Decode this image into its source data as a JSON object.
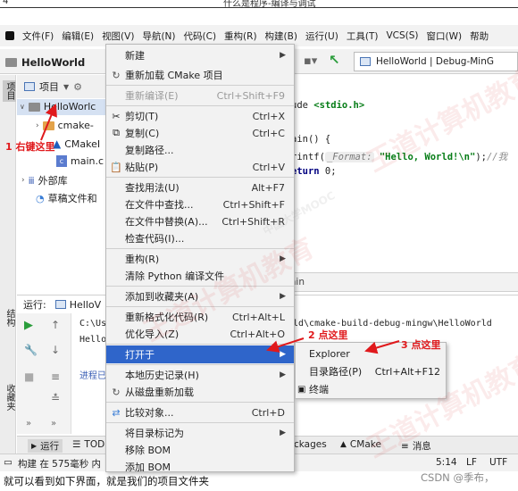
{
  "doc": {
    "page_number": "4",
    "header_title": "什么是程序-编译与调试",
    "caption": "就可以看到如下界面，就是我们的项目文件夹",
    "csdn_mark": "CSDN @季布，"
  },
  "menubar": {
    "items": [
      "文件(F)",
      "编辑(E)",
      "视图(V)",
      "导航(N)",
      "代码(C)",
      "重构(R)",
      "构建(B)",
      "运行(U)",
      "工具(T)",
      "VCS(S)",
      "窗口(W)",
      "帮助"
    ]
  },
  "toolbar": {
    "project_name": "HelloWorld",
    "run_config": "HelloWorld | Debug-MinG"
  },
  "left_strip": {
    "project_tab": "项目",
    "structure_tab": "结构",
    "favorites_tab": "收藏夹"
  },
  "project_panel": {
    "header_label": "项目",
    "tree": [
      {
        "label": "HelloWorlc",
        "indent": 0
      },
      {
        "label": "cmake-",
        "indent": 1
      },
      {
        "label": "CMakeI",
        "indent": 1
      },
      {
        "label": "main.c",
        "indent": 1
      },
      {
        "label": "外部库",
        "indent": 0
      },
      {
        "label": "草稿文件和",
        "indent": 0
      }
    ]
  },
  "editor": {
    "lines": [
      {
        "pre": "ude ",
        "kw": "",
        "str": "<stdio.h>",
        "hint": "",
        "post": "",
        "cmt": ""
      },
      {
        "pre": "ain() {",
        "kw": "",
        "str": "",
        "hint": "",
        "post": "",
        "cmt": ""
      },
      {
        "pre": "rintf(",
        "kw": "",
        "str": "\"Hello, World!\\n\"",
        "hint": "_Format:",
        "post": ");",
        "cmt": "//我"
      },
      {
        "pre": "",
        "kw": "eturn",
        "str": "",
        "hint": "",
        "post": " 0;",
        "cmt": ""
      }
    ],
    "tab_fragment": "ain"
  },
  "run_panel": {
    "label": "运行:",
    "tab": "HelloV",
    "console": [
      {
        "text": "C:\\Us",
        "tail": "ld\\cmake-build-debug-mingw\\HelloWorld"
      },
      {
        "text": "Hello",
        "tail": ""
      },
      {
        "text": "",
        "tail": ""
      },
      {
        "text": "进程已",
        "tail": ""
      }
    ]
  },
  "bottom_tabs": {
    "run": "运行",
    "todo": "TOD",
    "packages": "ckages",
    "cmake": "CMake",
    "messages": "消息"
  },
  "status_bar": {
    "build_msg": "构建 在 575毫秒 内",
    "position": "5:14",
    "line_sep": "LF",
    "encoding": "UTF"
  },
  "context_menu": {
    "items": [
      {
        "label": "新建",
        "shortcut": "",
        "submenu": true,
        "icon": "",
        "disabled": false
      },
      {
        "label": "重新加载 CMake 项目",
        "shortcut": "",
        "submenu": false,
        "icon": "cmake",
        "disabled": false
      },
      {
        "label": "重新编译(E)",
        "shortcut": "Ctrl+Shift+F9",
        "submenu": false,
        "icon": "",
        "disabled": true
      },
      {
        "label": "剪切(T)",
        "shortcut": "Ctrl+X",
        "submenu": false,
        "icon": "scissors",
        "disabled": false
      },
      {
        "label": "复制(C)",
        "shortcut": "Ctrl+C",
        "submenu": false,
        "icon": "copy",
        "disabled": false
      },
      {
        "label": "复制路径...",
        "shortcut": "",
        "submenu": false,
        "icon": "",
        "disabled": false
      },
      {
        "label": "粘贴(P)",
        "shortcut": "Ctrl+V",
        "submenu": false,
        "icon": "paste",
        "disabled": false
      },
      {
        "label": "查找用法(U)",
        "shortcut": "Alt+F7",
        "submenu": false,
        "icon": "",
        "disabled": false
      },
      {
        "label": "在文件中查找...",
        "shortcut": "Ctrl+Shift+F",
        "submenu": false,
        "icon": "",
        "disabled": false
      },
      {
        "label": "在文件中替换(A)...",
        "shortcut": "Ctrl+Shift+R",
        "submenu": false,
        "icon": "",
        "disabled": false
      },
      {
        "label": "检查代码(I)...",
        "shortcut": "",
        "submenu": false,
        "icon": "",
        "disabled": false
      },
      {
        "label": "重构(R)",
        "shortcut": "",
        "submenu": true,
        "icon": "",
        "disabled": false
      },
      {
        "label": "清除 Python 编译文件",
        "shortcut": "",
        "submenu": false,
        "icon": "",
        "disabled": false
      },
      {
        "label": "添加到收藏夹(A)",
        "shortcut": "",
        "submenu": true,
        "icon": "",
        "disabled": false
      },
      {
        "label": "重新格式化代码(R)",
        "shortcut": "Ctrl+Alt+L",
        "submenu": false,
        "icon": "",
        "disabled": false
      },
      {
        "label": "优化导入(Z)",
        "shortcut": "Ctrl+Alt+O",
        "submenu": false,
        "icon": "",
        "disabled": false
      },
      {
        "label": "打开于",
        "shortcut": "",
        "submenu": true,
        "icon": "",
        "disabled": false,
        "highlighted": true
      },
      {
        "label": "本地历史记录(H)",
        "shortcut": "",
        "submenu": true,
        "icon": "",
        "disabled": false
      },
      {
        "label": "从磁盘重新加载",
        "shortcut": "",
        "submenu": false,
        "icon": "reload",
        "disabled": false
      },
      {
        "label": "比较对象...",
        "shortcut": "Ctrl+D",
        "submenu": false,
        "icon": "compare",
        "disabled": false
      },
      {
        "label": "将目录标记为",
        "shortcut": "",
        "submenu": true,
        "icon": "",
        "disabled": false
      },
      {
        "label": "移除 BOM",
        "shortcut": "",
        "submenu": false,
        "icon": "",
        "disabled": false
      },
      {
        "label": "添加 BOM",
        "shortcut": "",
        "submenu": false,
        "icon": "",
        "disabled": false
      }
    ]
  },
  "submenu": {
    "items": [
      {
        "label": "Explorer",
        "shortcut": "",
        "icon": ""
      },
      {
        "label": "目录路径(P)",
        "shortcut": "Ctrl+Alt+F12",
        "icon": ""
      },
      {
        "label": "终端",
        "shortcut": "",
        "icon": "terminal"
      }
    ]
  },
  "annotations": {
    "step1": "1 右键这里",
    "step2": "2 点这里",
    "step3": "3 点这里"
  },
  "watermark": {
    "big": "王道计算机教育",
    "small": "中国大学MOOC"
  },
  "colors": {
    "annotation_red": "#e0191c",
    "highlight_blue": "#2f65ca",
    "keyword_navy": "#000080",
    "string_green": "#067d17"
  }
}
